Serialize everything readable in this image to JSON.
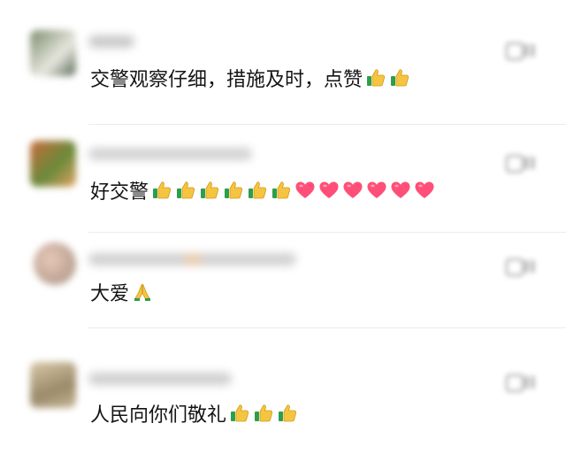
{
  "comments": [
    {
      "text": "交警观察仔细，措施及时，点赞",
      "emojis": [
        "thumbs-up-icon",
        "thumbs-up-icon"
      ]
    },
    {
      "text": "好交警",
      "emojis": [
        "thumbs-up-icon",
        "thumbs-up-icon",
        "thumbs-up-icon",
        "thumbs-up-icon",
        "thumbs-up-icon",
        "thumbs-up-icon",
        "heart-icon",
        "heart-icon",
        "heart-icon",
        "heart-icon",
        "heart-icon",
        "heart-icon"
      ]
    },
    {
      "text": "大爱",
      "emojis": [
        "folded-hands-icon"
      ]
    },
    {
      "text": "人民向你们敬礼",
      "emojis": [
        "thumbs-up-icon",
        "thumbs-up-icon",
        "thumbs-up-icon"
      ]
    }
  ],
  "colors": {
    "thumb": "#f5c542",
    "heart": "#ff4f78",
    "text": "#141414"
  }
}
